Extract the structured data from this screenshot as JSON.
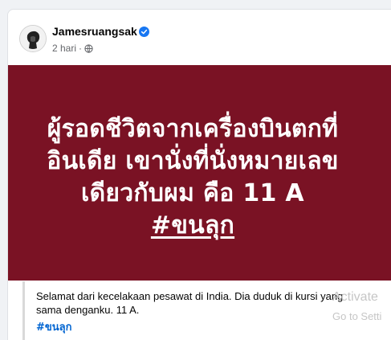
{
  "post": {
    "author": "Jamesruangsak",
    "time": "2 hari",
    "separator": "·",
    "banner_lines": [
      "ผู้รอดชีวิตจากเครื่องบินตกที่",
      "อินเดีย เขานั่งที่นั่งหมายเลข",
      "เดียวกับผม คือ 11 A"
    ],
    "banner_hashtag": "#ขนลุก",
    "caption": "Selamat dari kecelakaan pesawat di India. Dia duduk di kursi yang sama denganku. 11 A.",
    "hashtag": "#ขนลุก"
  },
  "watermark": {
    "line1": "Activate",
    "line2": "Go to Setti"
  },
  "icons": {
    "verified": "verified-badge-icon",
    "audience": "globe-icon",
    "more": "more-options-icon"
  },
  "colors": {
    "banner_bg": "#7a1224",
    "verified_blue": "#1877f2",
    "hashtag_blue": "#0064d1"
  }
}
